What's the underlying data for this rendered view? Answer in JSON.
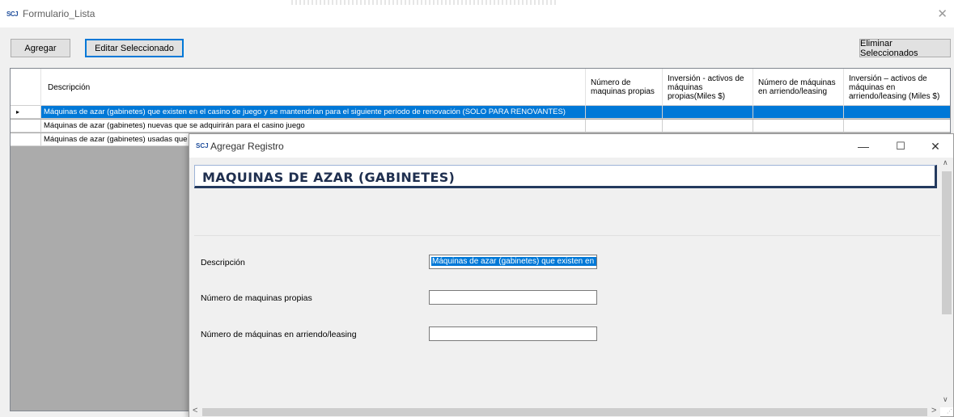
{
  "main_window": {
    "title": "Formulario_Lista",
    "icon_text": "SCJ",
    "close_glyph": "✕"
  },
  "toolbar": {
    "add_label": "Agregar",
    "edit_label": "Editar Seleccionado",
    "delete_label": "Eliminar Seleccionados"
  },
  "grid": {
    "columns": [
      "Descripción",
      "Número de maquinas propias",
      "Inversión - activos de máquinas propias(Miles $)",
      "Número de máquinas en arriendo/leasing",
      "Inversión – activos de máquinas en arriendo/leasing (Miles $)"
    ],
    "row_indicator": "▸",
    "rows": [
      "Máquinas de azar (gabinetes) que existen en el casino de juego  y se  mantendrían para el siguiente período de  renovación (SOLO PARA RENOVANTES)",
      "Máquinas de azar (gabinetes) nuevas que se adquirirán para el casino juego",
      "Máquinas de azar (gabinetes) usadas que"
    ]
  },
  "dialog": {
    "title": "Agregar Registro",
    "icon_text": "SCJ",
    "minimize_glyph": "—",
    "maximize_glyph": "☐",
    "close_glyph": "✕",
    "heading": "MAQUINAS DE AZAR (GABINETES)",
    "fields": {
      "descripcion_label": "Descripción",
      "descripcion_value": "Máquinas de azar (gabinetes) que existen en el",
      "propias_label": "Número de maquinas propias",
      "propias_value": "",
      "leasing_label": "Número de máquinas en arriendo/leasing",
      "leasing_value": ""
    },
    "scroll": {
      "up": "∧",
      "down": "∨",
      "left": "<",
      "right": ">"
    }
  }
}
